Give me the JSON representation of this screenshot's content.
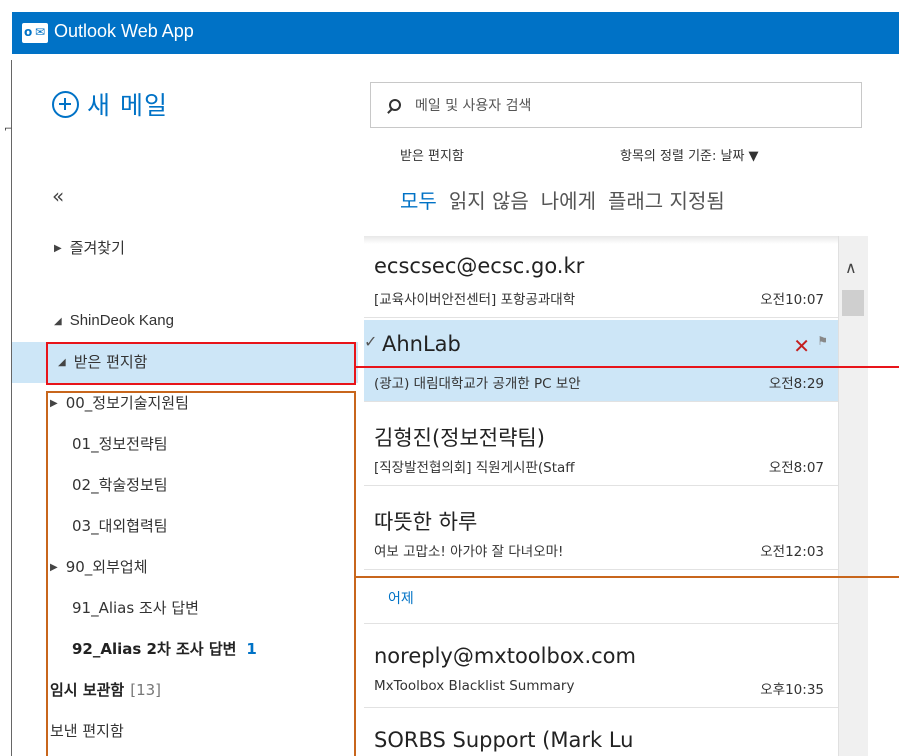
{
  "app": {
    "title": "Outlook Web App",
    "logo_text": "o⊠"
  },
  "sidebar": {
    "new_mail_label": "새 메일",
    "collapse_symbol": "«",
    "favorites_label": "즐겨찾기",
    "account_label": "ShinDeok Kang",
    "folders": [
      {
        "label": "받은 편지함",
        "expander": "◢"
      },
      {
        "label": "00_정보기술지원팀",
        "expander": "▶"
      },
      {
        "label": "01_정보전략팀"
      },
      {
        "label": "02_학술정보팀"
      },
      {
        "label": "03_대외협력팀"
      },
      {
        "label": "90_외부업체",
        "expander": "▶"
      },
      {
        "label": "91_Alias 조사 답변"
      },
      {
        "label": "92_Alias 2차 조사 답변",
        "count": "1"
      },
      {
        "label": "임시 보관함",
        "count": "[13]"
      },
      {
        "label": "보낸 편지함"
      }
    ]
  },
  "search": {
    "placeholder": "메일 및 사용자 검색"
  },
  "list": {
    "folder_title": "받은 편지함",
    "sort_label": "항목의 정렬 기준: 날짜 ▼",
    "filters": [
      "모두",
      "읽지 않음",
      "나에게",
      "플래그 지정됨"
    ],
    "day_divider": "어제",
    "messages": [
      {
        "sender": "ecscsec@ecsc.go.kr",
        "subject": "[교육사이버안전센터] 포항공과대학",
        "time": "오전10:07"
      },
      {
        "sender": "AhnLab",
        "subject": "(광고) 대림대학교가 공개한 PC 보안",
        "time": "오전8:29"
      },
      {
        "sender": "김형진(정보전략팀)",
        "subject": "[직장발전협의회] 직원게시판(Staff",
        "time": "오전8:07"
      },
      {
        "sender": "따뜻한 하루",
        "subject": "여보 고맙소! 아가야 잘 다녀오마!",
        "time": "오전12:03"
      },
      {
        "sender": "noreply@mxtoolbox.com",
        "subject": "MxToolbox Blacklist Summary",
        "time": "오후10:35"
      },
      {
        "sender": "SORBS Support (Mark Lu",
        "subject": "",
        "time": ""
      }
    ]
  },
  "colors": {
    "accent": "#0072c6",
    "highlight_red": "#e8141a",
    "highlight_orange": "#c8661c",
    "selected_bg": "#cde6f7"
  }
}
